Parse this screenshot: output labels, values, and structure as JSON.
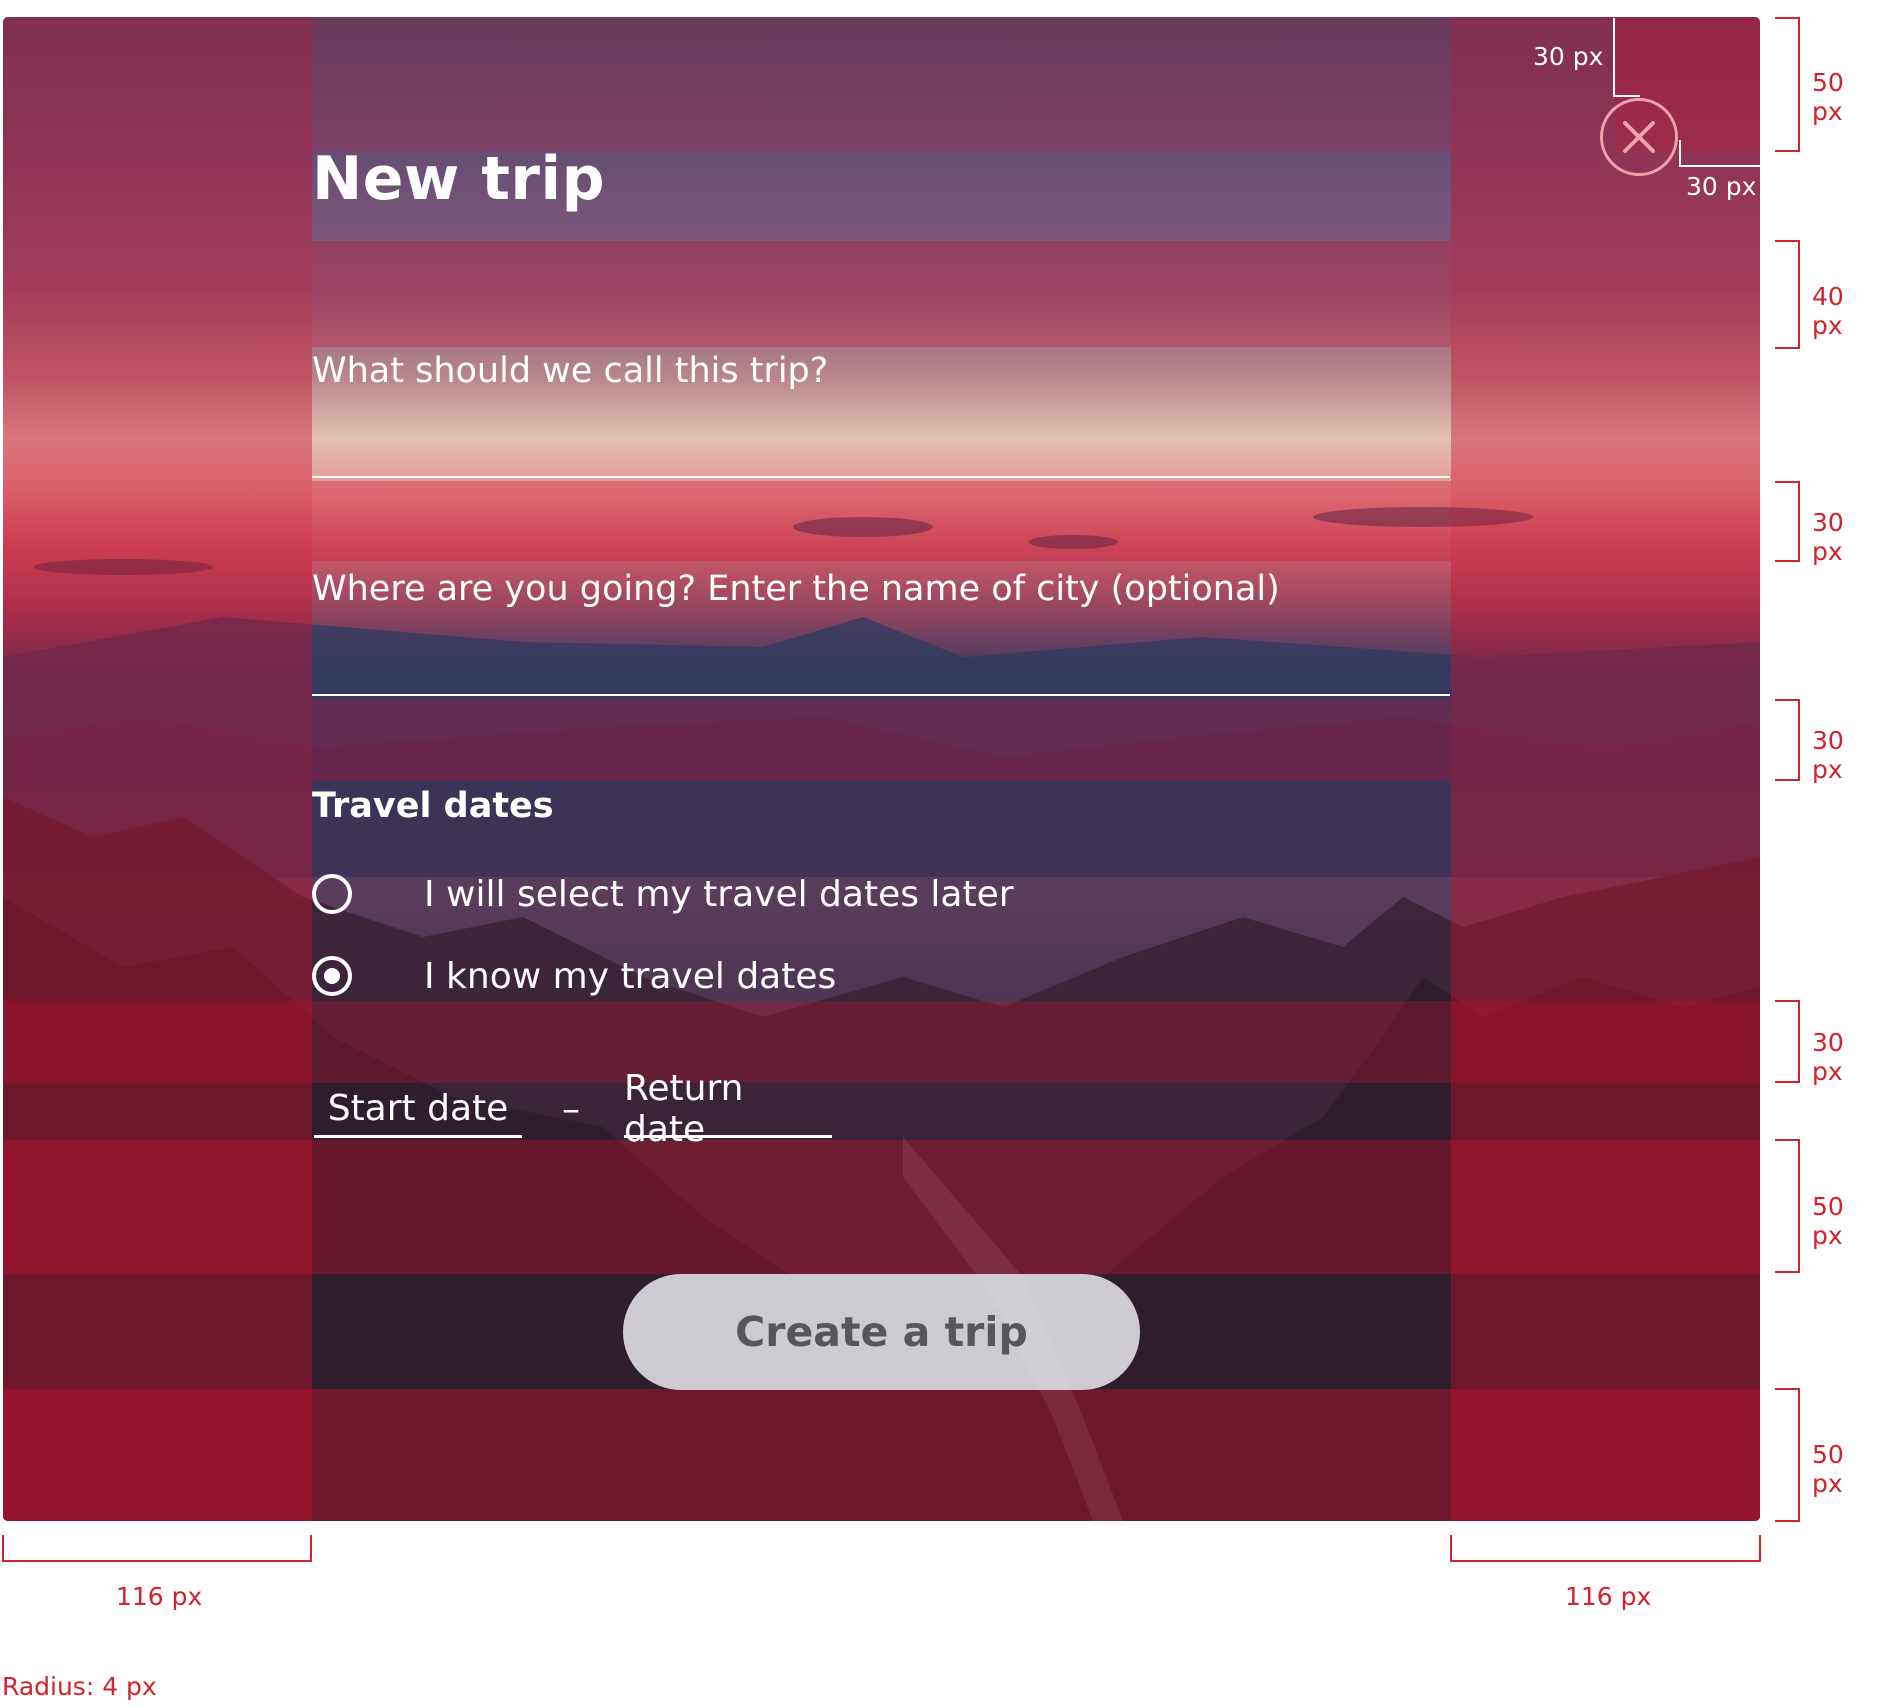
{
  "modal": {
    "title": "New trip",
    "trip_name_placeholder": "What should we call this trip?",
    "city_placeholder": "Where are you going? Enter the name of city (optional)",
    "travel_dates_label": "Travel dates",
    "options": [
      {
        "label": "I will select my travel dates later",
        "selected": false
      },
      {
        "label": "I know my travel dates",
        "selected": true
      }
    ],
    "start_date_label": "Start date",
    "date_separator": "–",
    "return_date_label": "Return date",
    "create_button_label": "Create a trip",
    "close_icon": "close-icon"
  },
  "annotations": {
    "close_offset_top": "30 px",
    "close_offset_right": "30 px",
    "right_gaps": [
      "50 px",
      "40 px",
      "30 px",
      "30 px",
      "30 px",
      "50 px",
      "50 px"
    ],
    "side_margin_left": "116 px",
    "side_margin_right": "116 px",
    "radius": "Radius: 4 px"
  },
  "colors": {
    "annotation_red": "#d1222d",
    "close_ring": "#f0a1ab",
    "button_bg": "#e4e2e8",
    "button_text": "#58555c"
  }
}
